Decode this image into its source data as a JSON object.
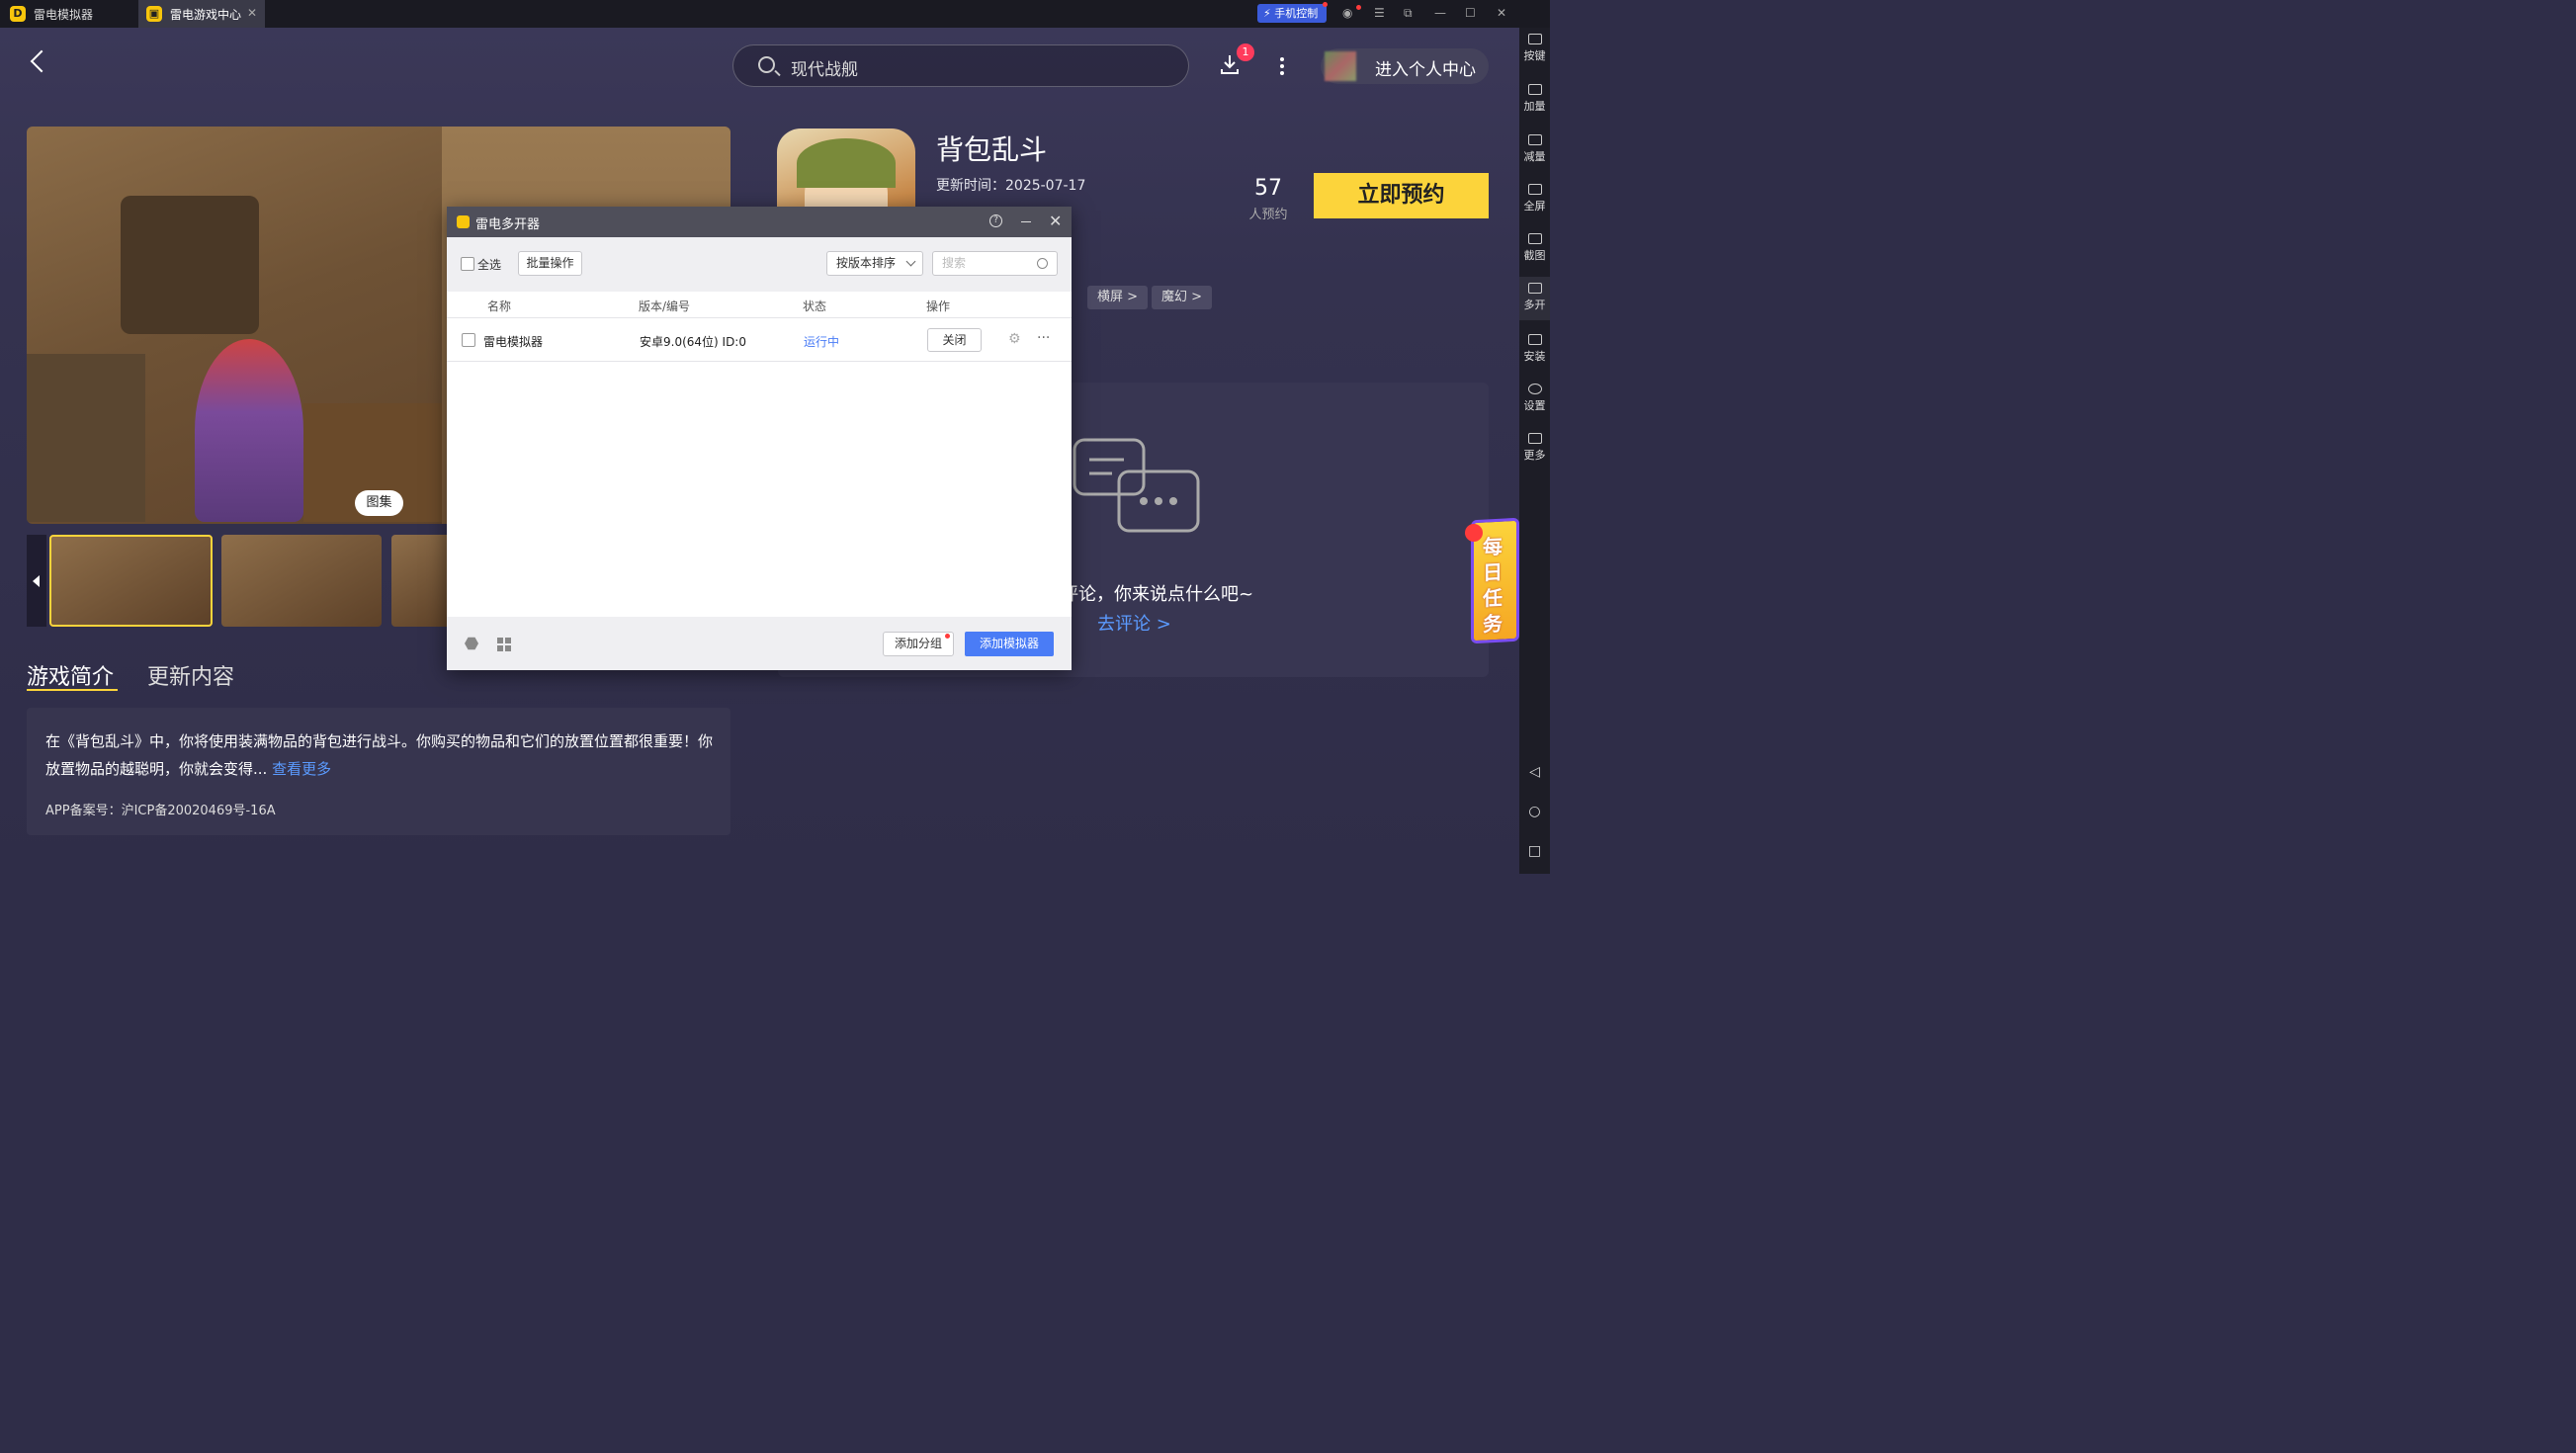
{
  "titlebar": {
    "tabs": [
      {
        "label": "雷电模拟器"
      },
      {
        "label": "雷电游戏中心"
      }
    ],
    "phone_control": "手机控制"
  },
  "header": {
    "search_placeholder": "现代战舰",
    "download_badge": "1",
    "user_center": "进入个人中心"
  },
  "gallery": {
    "button": "图集"
  },
  "game": {
    "title": "背包乱斗",
    "update_time": "更新时间：2025-07-17",
    "reserve_count": "57",
    "reserve_label": "人预约",
    "reserve_button": "立即预约",
    "tags": [
      "横屏 >",
      "魔幻 >"
    ]
  },
  "comments": {
    "empty_text": "评论，你来说点什么吧~",
    "go_comment": "去评论 >"
  },
  "detail_tabs": {
    "intro": "游戏简介",
    "update": "更新内容"
  },
  "description": {
    "text": "在《背包乱斗》中，你将使用装满物品的背包进行战斗。你购买的物品和它们的放置位置都很重要！你放置物品的越聪明，你就会变得...",
    "more": "查看更多",
    "icp": "APP备案号：沪ICP备20020469号-16A"
  },
  "daily_task": "每日任务",
  "sidebar": {
    "items": [
      {
        "label": "按键"
      },
      {
        "label": "加量"
      },
      {
        "label": "减量"
      },
      {
        "label": "全屏"
      },
      {
        "label": "截图"
      },
      {
        "label": "多开"
      },
      {
        "label": "安装"
      },
      {
        "label": "设置"
      },
      {
        "label": "更多"
      }
    ]
  },
  "dialog": {
    "title": "雷电多开器",
    "select_all": "全选",
    "batch": "批量操作",
    "sort": "按版本排序",
    "search_placeholder": "搜索",
    "columns": {
      "name": "名称",
      "version": "版本/编号",
      "status": "状态",
      "action": "操作"
    },
    "rows": [
      {
        "name": "雷电模拟器",
        "version": "安卓9.0(64位)  ID:0",
        "status": "运行中",
        "action": "关闭"
      }
    ],
    "add_group": "添加分组",
    "add_emulator": "添加模拟器"
  }
}
